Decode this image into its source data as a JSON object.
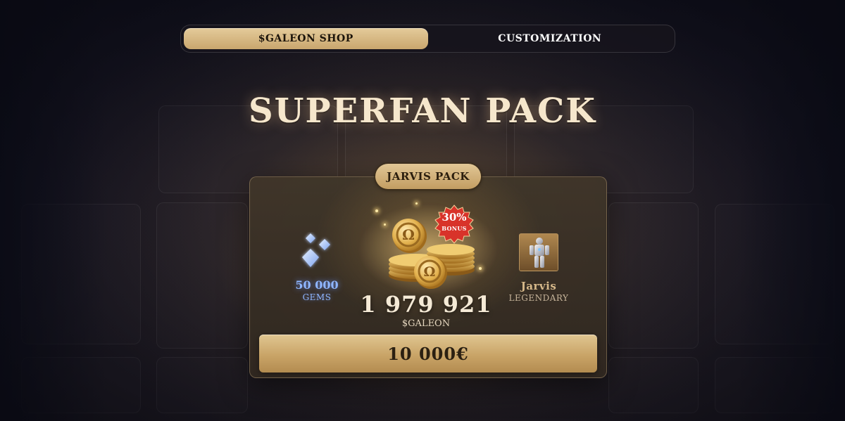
{
  "tabs": [
    {
      "label": "$GALEON SHOP",
      "active": true
    },
    {
      "label": "CUSTOMIZATION",
      "active": false
    }
  ],
  "title": "SUPERFAN PACK",
  "pack": {
    "name": "JARVIS PACK",
    "gems": {
      "amount": "50 000",
      "label": "GEMS",
      "icon": "diamond-gems-icon"
    },
    "coins": {
      "amount": "1 979 921",
      "label": "$GALEON",
      "icon": "galeon-coins-icon",
      "bonus_percent": "30%",
      "bonus_label": "BONUS"
    },
    "hero": {
      "name": "Jarvis",
      "rarity": "LEGENDARY",
      "icon": "jarvis-character-icon"
    },
    "price": "10 000€"
  },
  "colors": {
    "accent_gold": "#c9a66e",
    "gems_blue": "#8fb6ff",
    "bonus_red": "#d8332a",
    "background": "#15141f"
  }
}
